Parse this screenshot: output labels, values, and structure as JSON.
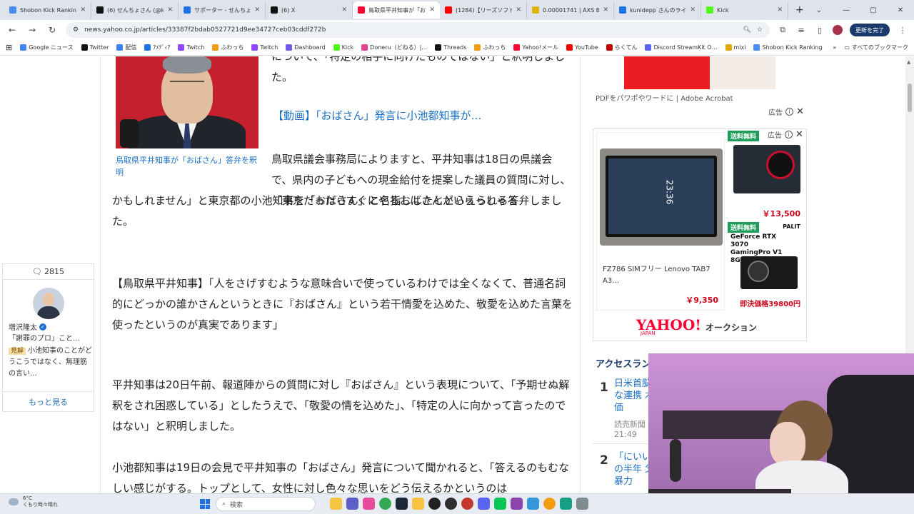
{
  "browser": {
    "tabs": [
      {
        "label": "Shobon Kick Ranking",
        "color": "#4a8df0",
        "active": false
      },
      {
        "label": "(6) せんちょさん (@kur…",
        "color": "#111111",
        "active": false
      },
      {
        "label": "サポーター - せんちょさん",
        "color": "#1a73e8",
        "active": false
      },
      {
        "label": "(6) X",
        "color": "#111111",
        "active": false
      },
      {
        "label": "鳥取県平井知事が「お…",
        "color": "#ff0033",
        "active": true
      },
      {
        "label": "(1284)【リーズソフト…",
        "color": "#ff0000",
        "active": false
      },
      {
        "label": "0.00001741 | AXS BTC…",
        "color": "#e0b400",
        "active": false
      },
      {
        "label": "kunidepp さんのライブ…",
        "color": "#1a73e8",
        "active": false
      },
      {
        "label": "Kick",
        "color": "#53fc18",
        "active": false
      }
    ],
    "new_tab_label": "+",
    "url": "news.yahoo.co.jp/articles/33387f2bdab0527721d9ee34727ceb03cddf272b",
    "update_button": "更新を完了",
    "bookmarks": [
      {
        "label": "Google ニュース",
        "color": "#4285f4"
      },
      {
        "label": "Twitter",
        "color": "#111111"
      },
      {
        "label": "配信",
        "color": "#3b82f6"
      },
      {
        "label": "ｱﾒﾃﾞｨｱ",
        "color": "#1a73e8"
      },
      {
        "label": "Twitch",
        "color": "#9146ff"
      },
      {
        "label": "ふわっち",
        "color": "#f39c12"
      },
      {
        "label": "Twitch",
        "color": "#9146ff"
      },
      {
        "label": "Dashboard",
        "color": "#6c5ce7"
      },
      {
        "label": "Kick",
        "color": "#53fc18"
      },
      {
        "label": "Doneru（どねる）|…",
        "color": "#e84393"
      },
      {
        "label": "Threads",
        "color": "#111111"
      },
      {
        "label": "ふわっち",
        "color": "#f39c12"
      },
      {
        "label": "Yahoo!メール",
        "color": "#ff0033"
      },
      {
        "label": "YouTube",
        "color": "#ff0000"
      },
      {
        "label": "らくてん",
        "color": "#bf0000"
      },
      {
        "label": "Discord StreamKit O…",
        "color": "#5865f2"
      },
      {
        "label": "mixi",
        "color": "#e0a800"
      },
      {
        "label": "Shobon Kick Ranking",
        "color": "#4a8df0"
      }
    ],
    "all_bookmarks": "すべてのブックマーク"
  },
  "comments": {
    "count": "2815",
    "name": "増沢隆太",
    "subtitle": "「謝罪のプロ」こと…",
    "badge": "見解",
    "view": "小池知事のことがどうこうではなく、無理筋の言い…",
    "more": "もっと見る"
  },
  "article": {
    "top_text": "について、「特定の相手に向けたものではない」と釈明しました。",
    "caption": "鳥取県平井知事が「おばさん」答弁を釈明",
    "video_link": "【動画】「おばさん」発言に小池都知事が…",
    "para1a": "鳥取県議会事務局によりますと、平井知事は18日の県議会で、県内の子どもへの現金給付を提案した議員の質問に対し、「東京だったらすぐにやるおばさんがいらっしゃる",
    "para1b": "かもしれません」と東京都の小池知事を「おばさん」と名指ししたととらえられる答弁しました。",
    "para2": "【鳥取県平井知事】「人をさげすむような意味合いで使っているわけでは全くなくて、普通名詞的にどっかの誰かさんというときに『おばさん』という若干情愛を込めた、敬愛を込めた言葉を使ったというのが真実であります」",
    "para3": "平井知事は20日午前、報道陣からの質問に対し『おばさん』という表現について、「予期せぬ解釈をされ困惑している」としたうえで、「敬愛の情を込めた」、「特定の人に向かって言ったのではない」と釈明しました。",
    "para4": "小池都知事は19日の会見で平井知事の「おばさん」発言について聞かれると、「答えるのもむなしい感じがする。トップとして、女性に対し色々な思いをどう伝えるかというのは"
  },
  "ads": {
    "top_caption": "PDFをパワポやワードに | Adobe Acrobat",
    "ad_label": "広告",
    "free_shipping": "送料無料",
    "main_product_title": "FZ786 SIMフリー Lenovo TAB7 A3…",
    "main_product_price": "￥9,350",
    "tablet_clock": "23:36",
    "side1_price": "￥13,500",
    "side2_name": "GeForce RTX 3070 GamingPro V1 8GB",
    "side2_brand": "PALIT",
    "side2_price": "即決価格39800円",
    "yahoo_logo": "YAHOO!",
    "yahoo_japan": "JAPAN",
    "auction_label": "オークション"
  },
  "ranking": {
    "title": "アクセスランキング",
    "items": [
      {
        "rank": "1",
        "text": "日米首脳 密な連携 木評価",
        "source": "読売新聞",
        "time": "21:49"
      },
      {
        "rank": "2",
        "text": "「にいい 獄の半年 父の暴力",
        "source": "",
        "time": ""
      }
    ]
  },
  "taskbar": {
    "temperature": "6°C",
    "weather": "くもり時々晴れ",
    "search_placeholder": "検索"
  }
}
